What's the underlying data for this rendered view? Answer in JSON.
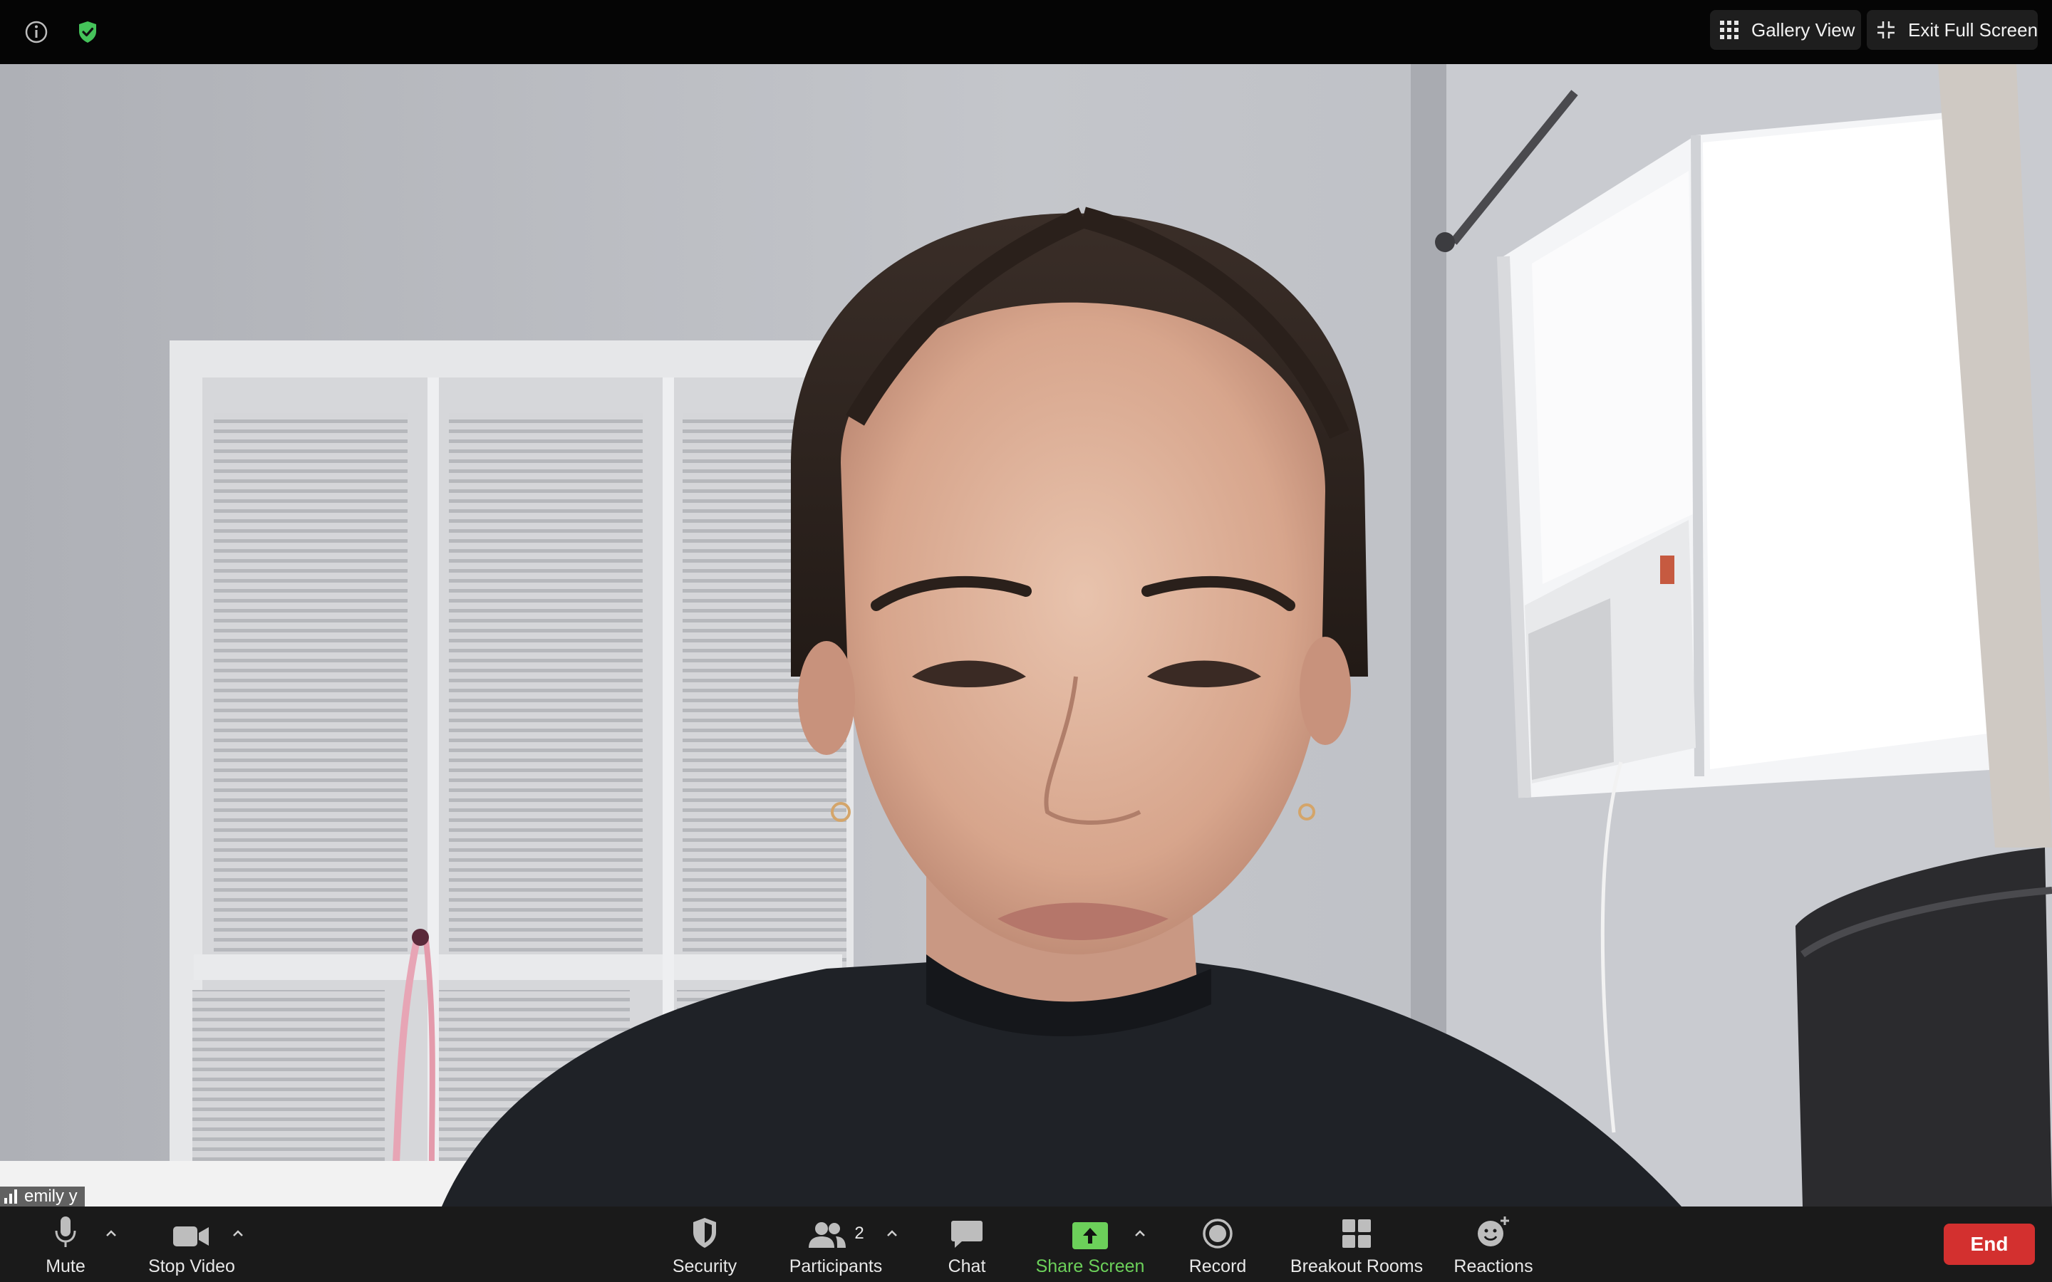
{
  "top_bar": {
    "info_icon": "info-icon",
    "security_status_icon": "shield-check-icon",
    "gallery_view_label": "Gallery View",
    "exit_full_screen_label": "Exit Full Screen"
  },
  "video": {
    "participant_name": "emily y"
  },
  "toolbar": {
    "mute_label": "Mute",
    "stop_video_label": "Stop Video",
    "security_label": "Security",
    "participants_label": "Participants",
    "participants_count": "2",
    "chat_label": "Chat",
    "share_screen_label": "Share Screen",
    "record_label": "Record",
    "breakout_rooms_label": "Breakout Rooms",
    "reactions_label": "Reactions",
    "end_label": "End"
  },
  "colors": {
    "share_screen_accent": "#6cd05a",
    "end_button": "#d3302f",
    "security_shield": "#45c35a"
  }
}
